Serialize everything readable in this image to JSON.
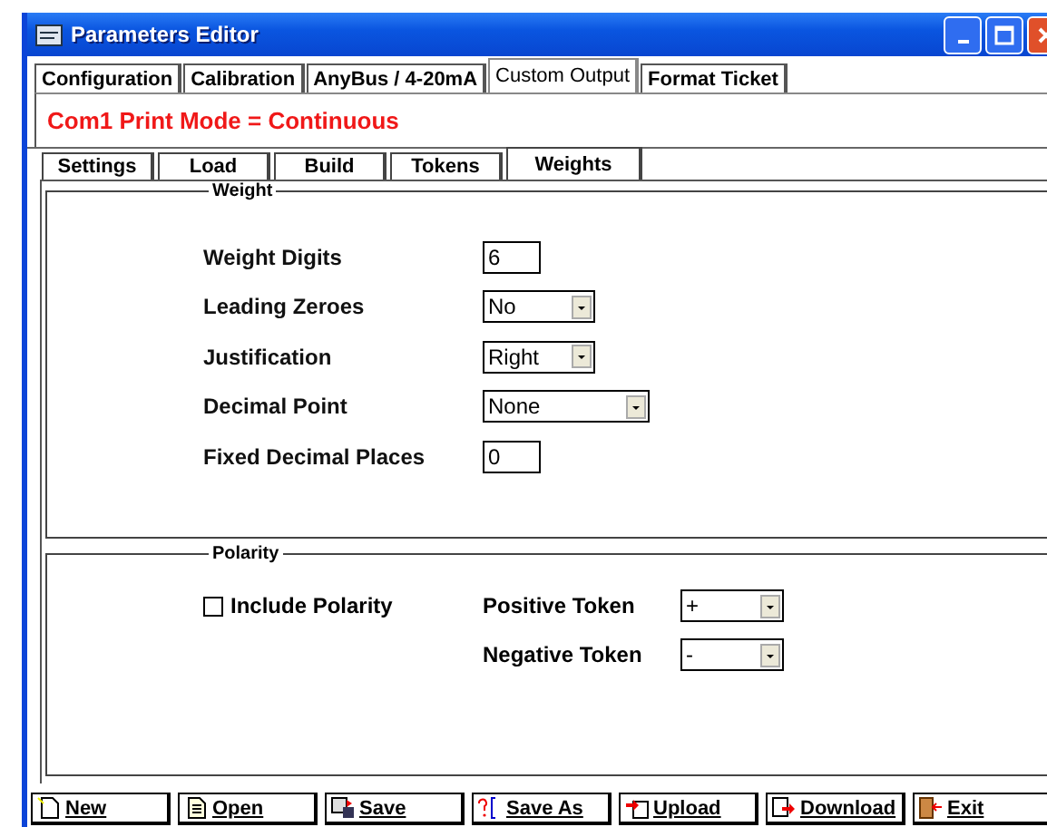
{
  "window": {
    "title": "Parameters Editor"
  },
  "tabs": [
    {
      "label": "Configuration",
      "selected": false
    },
    {
      "label": "Calibration",
      "selected": false
    },
    {
      "label": "AnyBus / 4-20mA",
      "selected": false
    },
    {
      "label": "Custom Output",
      "selected": true
    },
    {
      "label": "Format Ticket",
      "selected": false
    }
  ],
  "mode_banner": "Com1 Print Mode = Continuous",
  "sub_tabs": [
    {
      "label": "Settings",
      "selected": false
    },
    {
      "label": "Load",
      "selected": false
    },
    {
      "label": "Build",
      "selected": false
    },
    {
      "label": "Tokens",
      "selected": false
    },
    {
      "label": "Weights",
      "selected": true
    }
  ],
  "weight": {
    "title": "Weight",
    "fields": [
      {
        "label": "Weight Digits",
        "kind": "text",
        "value": "6"
      },
      {
        "label": "Leading Zeroes",
        "kind": "dropdown",
        "value": "No"
      },
      {
        "label": "Justification",
        "kind": "dropdown",
        "value": "Right"
      },
      {
        "label": "Decimal Point",
        "kind": "dropdown",
        "value": "None"
      },
      {
        "label": "Fixed Decimal Places",
        "kind": "text",
        "value": "0"
      }
    ]
  },
  "polarity": {
    "title": "Polarity",
    "include": {
      "label": "Include Polarity",
      "checked": false
    },
    "tokens": [
      {
        "label": "Positive Token",
        "value": "+"
      },
      {
        "label": "Negative Token",
        "value": "-"
      }
    ]
  },
  "buttons": [
    {
      "label": "New"
    },
    {
      "label": "Open"
    },
    {
      "label": "Save"
    },
    {
      "label": "Save As"
    },
    {
      "label": "Upload"
    },
    {
      "label": "Download"
    },
    {
      "label": "Exit"
    }
  ]
}
